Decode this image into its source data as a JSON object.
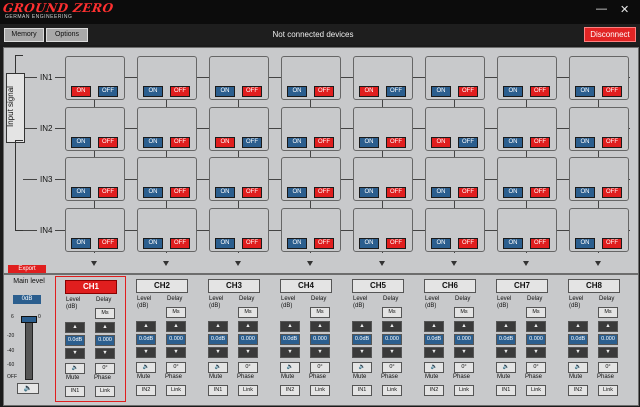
{
  "app": {
    "logo": "GROUND ZERO",
    "logo_sub": "GERMAN ENGINEERING"
  },
  "window_controls": {
    "minimize": "—",
    "close": "✕"
  },
  "toolbar": {
    "memory": "Memory",
    "options": "Options",
    "status": "Not connected devices",
    "disconnect": "Disconnect"
  },
  "matrix": {
    "side_label": "Input signal",
    "rows": [
      "IN1",
      "IN2",
      "IN3",
      "IN4"
    ],
    "on_label": "ON",
    "off_label": "OFF",
    "states": [
      [
        "on",
        "off",
        "off",
        "off",
        "on",
        "off",
        "off",
        "off"
      ],
      [
        "off",
        "off",
        "on",
        "off",
        "off",
        "on",
        "off",
        "off"
      ],
      [
        "off",
        "off",
        "off",
        "off",
        "off",
        "off",
        "off",
        "off"
      ],
      [
        "off",
        "off",
        "off",
        "off",
        "off",
        "off",
        "off",
        "off"
      ]
    ],
    "export_label": "Export"
  },
  "main_level": {
    "label": "Main level",
    "value": "0dB",
    "ticks": [
      "6",
      "0",
      "-20",
      "-40",
      "-60",
      "OFF"
    ],
    "speaker_icon": "🔈"
  },
  "channels": [
    {
      "name": "CH1",
      "input": "IN1",
      "selected": true
    },
    {
      "name": "CH2",
      "input": "IN2",
      "selected": false
    },
    {
      "name": "CH3",
      "input": "IN1",
      "selected": false
    },
    {
      "name": "CH4",
      "input": "IN2",
      "selected": false
    },
    {
      "name": "CH5",
      "input": "IN1",
      "selected": false
    },
    {
      "name": "CH6",
      "input": "IN2",
      "selected": false
    },
    {
      "name": "CH7",
      "input": "IN1",
      "selected": false
    },
    {
      "name": "CH8",
      "input": "IN2",
      "selected": false
    }
  ],
  "channel_ui": {
    "level_label": "Level\n(dB)",
    "delay_label": "Delay",
    "delay_unit": "Ms",
    "level_value": "0.0dB",
    "delay_value": "0.000",
    "phase_value": "0°",
    "mute_label": "Mute",
    "phase_label": "Phase",
    "link_label": "Link",
    "up_icon": "▲",
    "down_icon": "▼",
    "speaker_icon": "🔈"
  },
  "colors": {
    "active": "#e01e1e",
    "inactive": "#2b5e8e"
  }
}
